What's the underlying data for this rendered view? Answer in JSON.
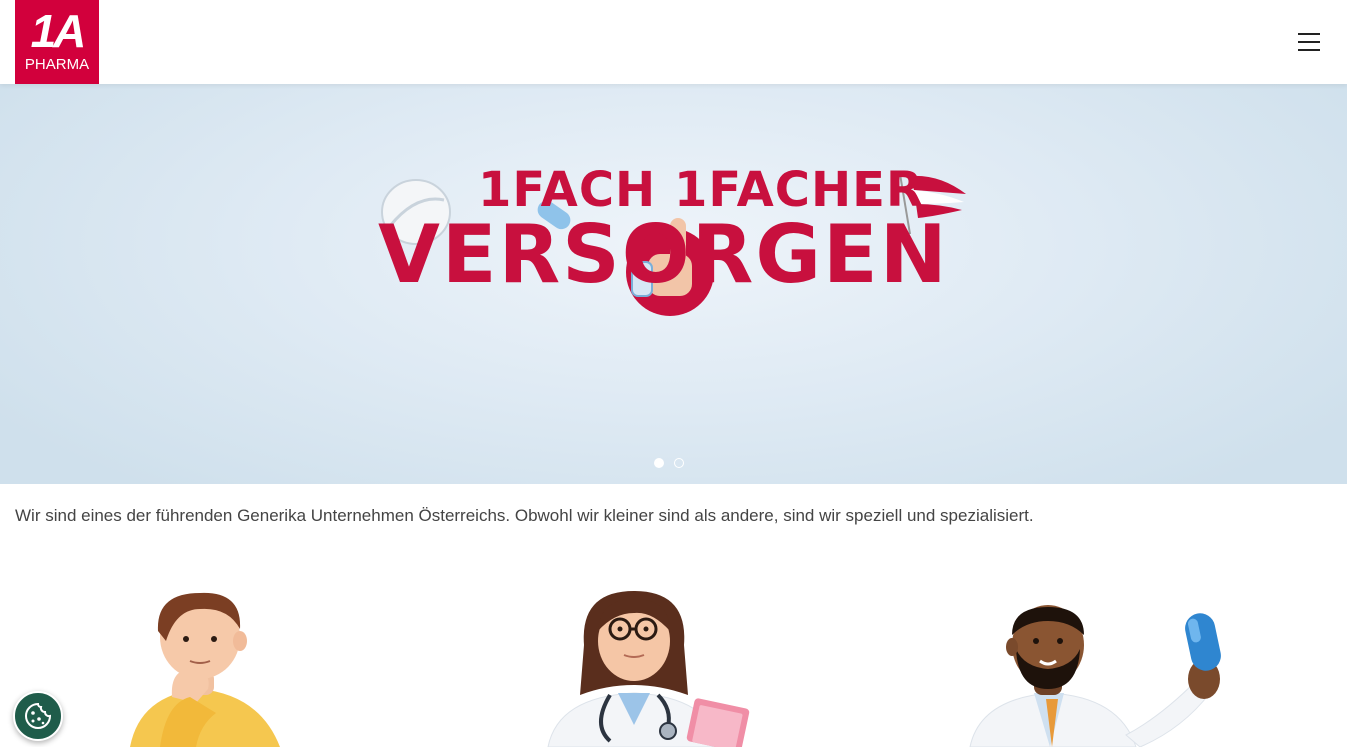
{
  "header": {
    "logo_top": "1A",
    "logo_bottom": "PHARMA",
    "menu_icon": "hamburger-menu-icon"
  },
  "hero": {
    "line1": "1FACH 1FACHER",
    "line2": "VERSORGEN",
    "slides_total": 2,
    "active_slide": 1
  },
  "intro": {
    "text": "Wir sind eines der führenden Generika Unternehmen Österreichs. Obwohl wir kleiner sind als andere, sind wir speziell und spezialisiert."
  },
  "figures": {
    "person_1": "thinking-man-illustration",
    "person_2": "female-doctor-illustration",
    "person_3": "pharmacist-with-pill-illustration"
  },
  "cookie": {
    "icon": "cookie-icon"
  },
  "colors": {
    "brand_red": "#d2003c",
    "hero_text": "#c8103e",
    "cookie_bg": "#1f5c4a"
  }
}
